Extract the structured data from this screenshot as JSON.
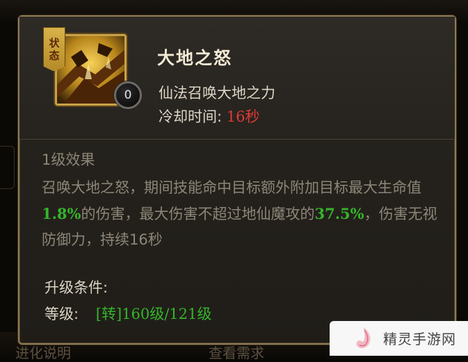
{
  "skill": {
    "state_tag_line1": "状",
    "state_tag_line2": "态",
    "name": "大地之怒",
    "level": "0",
    "description": "仙法召唤大地之力",
    "cooldown_label": "冷却时间:",
    "cooldown_value": "16秒"
  },
  "effect": {
    "title": "1级效果",
    "text_part1": "召唤大地之怒，期间技能命中目标额外附加目标最大生命值",
    "highlight1": "1.8%",
    "text_part2": "的伤害，最大伤害不超过地仙魔攻的",
    "highlight2": "37.5%",
    "text_part3": "，伤害无视防御力，持续16秒"
  },
  "requirement": {
    "title": "升级条件:",
    "level_label": "等级:",
    "level_value": "[转]160级/121级"
  },
  "background": {
    "bottom_left_text": "进化说明",
    "bottom_mid_text": "查看需求"
  },
  "watermark": {
    "text": "精灵手游网",
    "logo": "j-logo-icon"
  },
  "colors": {
    "panel_border": "#8f7b52",
    "cooldown_red": "#e23a34",
    "highlight_green": "#36b52a",
    "icon_gold": "#c9a24a"
  }
}
